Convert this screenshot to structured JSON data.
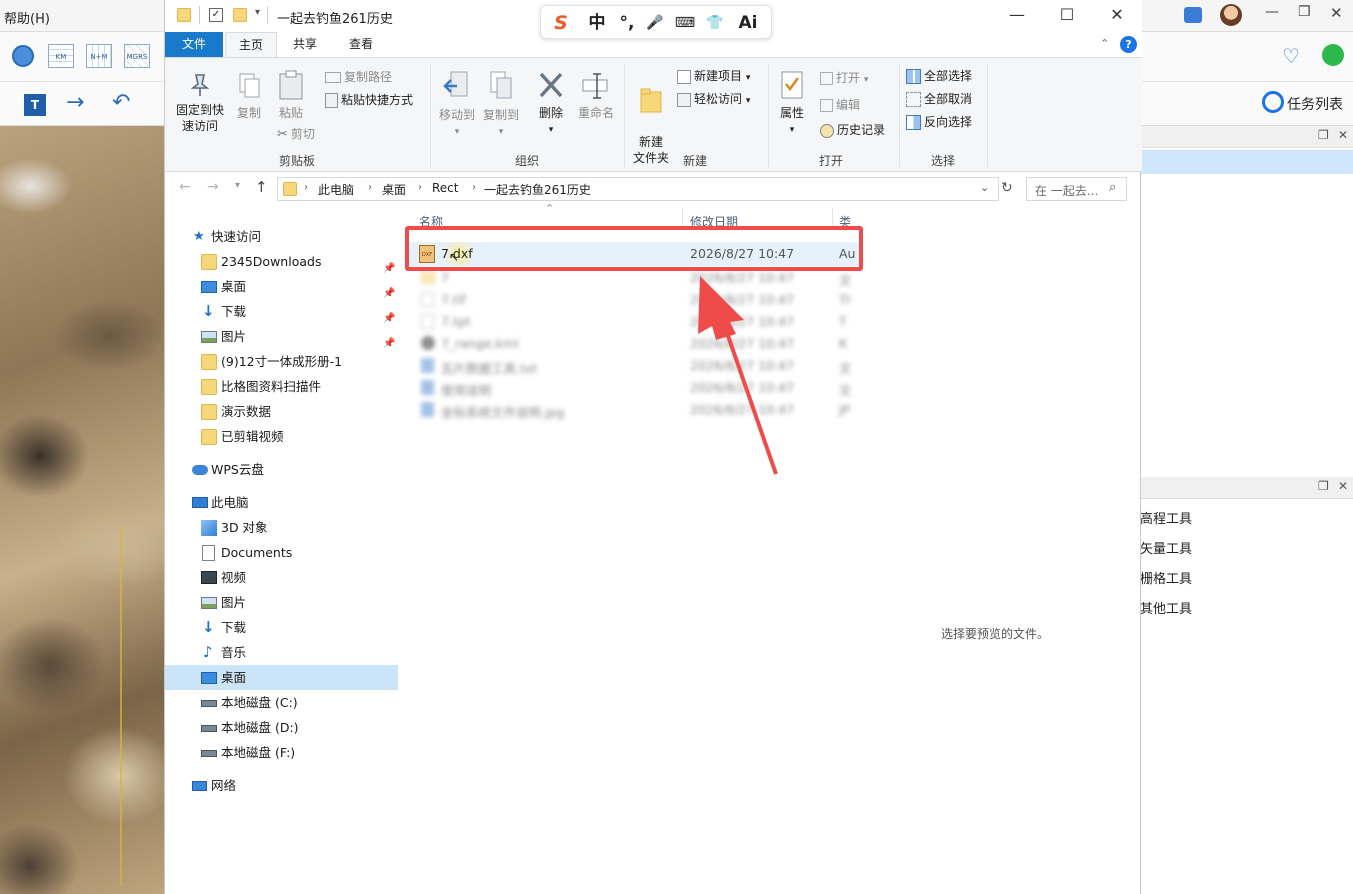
{
  "background_app": {
    "menu_help": "帮助(H)",
    "task_list": "任务列表",
    "tools": [
      "高程工具",
      "矢量工具",
      "栅格工具",
      "其他工具"
    ],
    "tool_icons": [
      "Lng",
      "KM",
      "N+M",
      "MGRS"
    ]
  },
  "window": {
    "title": "一起去钓鱼261历史",
    "minimize": "—",
    "maximize": "☐",
    "close": "✕"
  },
  "ime": {
    "logo": "S",
    "items": [
      "中",
      "°,",
      "🎤",
      "⌨",
      "👕",
      "Ai"
    ]
  },
  "ribbon": {
    "tabs": [
      "文件",
      "主页",
      "共享",
      "查看"
    ],
    "active_tab": "主页",
    "groups": {
      "clipboard": {
        "label": "剪贴板",
        "pin": "固定到快速访问",
        "copy": "复制",
        "paste": "粘贴",
        "copy_path": "复制路径",
        "paste_shortcut": "粘贴快捷方式",
        "cut": "剪切"
      },
      "organize": {
        "label": "组织",
        "move_to": "移动到",
        "copy_to": "复制到",
        "delete": "删除",
        "rename": "重命名"
      },
      "new": {
        "label": "新建",
        "new_folder": "新建\n文件夹",
        "new_item": "新建项目",
        "easy_access": "轻松访问"
      },
      "open": {
        "label": "打开",
        "properties": "属性",
        "open": "打开",
        "edit": "编辑",
        "history": "历史记录"
      },
      "select": {
        "label": "选择",
        "select_all": "全部选择",
        "select_none": "全部取消",
        "invert": "反向选择"
      }
    }
  },
  "address": {
    "crumbs": [
      "此电脑",
      "桌面",
      "Rect",
      "一起去钓鱼261历史"
    ],
    "search_placeholder": "在 一起去..."
  },
  "nav": {
    "quick_access": "快速访问",
    "quick_items": [
      "2345Downloads",
      "桌面",
      "下载",
      "图片",
      "(9)12寸一体成形册-1",
      "比格图资料扫描件",
      "演示数据",
      "已剪辑视频"
    ],
    "wps": "WPS云盘",
    "this_pc": "此电脑",
    "pc_items": [
      "3D 对象",
      "Documents",
      "视频",
      "图片",
      "下载",
      "音乐",
      "桌面",
      "本地磁盘 (C:)",
      "本地磁盘 (D:)",
      "本地磁盘 (F:)"
    ],
    "network": "网络",
    "selected": "桌面"
  },
  "files": {
    "columns": [
      "名称",
      "修改日期",
      "类"
    ],
    "highlighted": {
      "name": "7.dxf",
      "date": "2026/8/27 10:47",
      "type": "Au"
    },
    "blurred_rows": [
      {
        "name": "7",
        "date": "2026/8/27 10:47",
        "type": "文"
      },
      {
        "name": "7.tif",
        "date": "2026/8/27 10:47",
        "type": "TI"
      },
      {
        "name": "7.tpt",
        "date": "2026/8/27 10:47",
        "type": "T"
      },
      {
        "name": "7_range.kml",
        "date": "2026/8/27 10:47",
        "type": "K"
      },
      {
        "name": "瓦片数据工具.txt",
        "date": "2026/8/27 10:47",
        "type": "文"
      },
      {
        "name": "使用说明",
        "date": "2026/8/27 10:47",
        "type": "文"
      },
      {
        "name": "坐标系统文件说明.jpg",
        "date": "2026/8/27 10:47",
        "type": "JP"
      }
    ],
    "preview_hint": "选择要预览的文件。"
  },
  "colors": {
    "accent": "#1a73e8",
    "annotation": "#ef4b4b",
    "selection": "#cce4f7",
    "file_tab": "#1979ca"
  }
}
